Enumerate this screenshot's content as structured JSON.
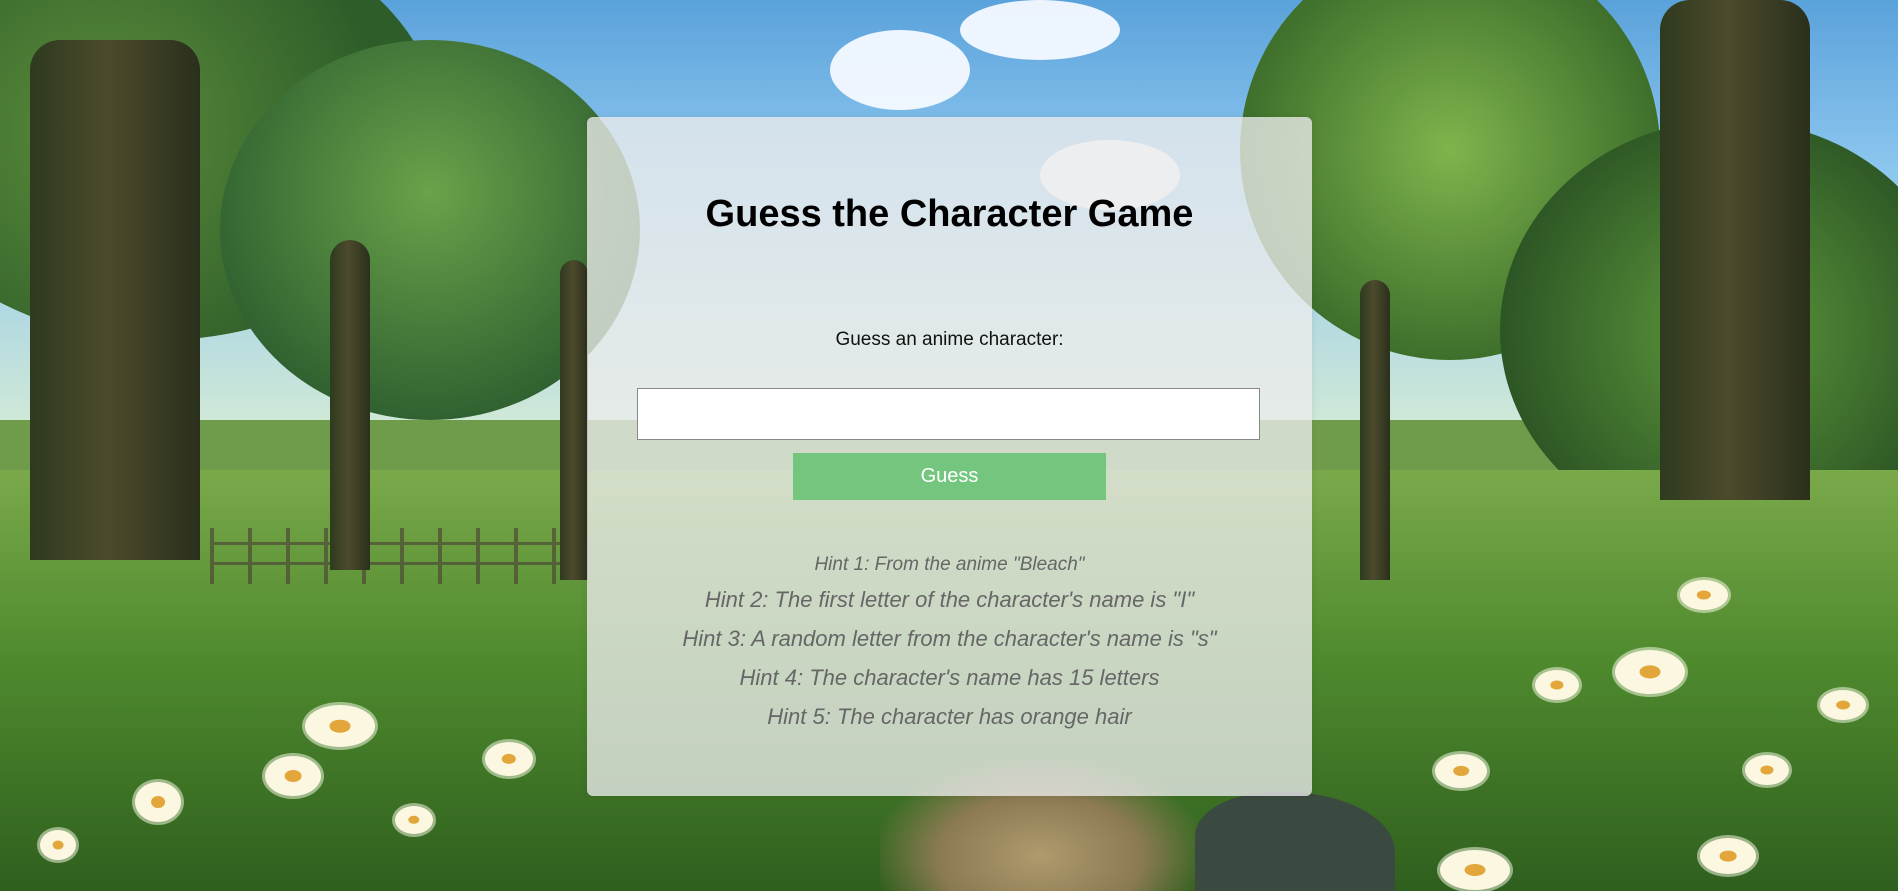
{
  "game": {
    "title": "Guess the Character Game",
    "prompt_label": "Guess an anime character:",
    "input_value": "",
    "input_placeholder": "",
    "guess_button_label": "Guess"
  },
  "hints": [
    "Hint 1: From the anime \"Bleach\"",
    "Hint 2: The first letter of the character's name is \"I\"",
    "Hint 3: A random letter from the character's name is \"s\"",
    "Hint 4: The character's name has 15 letters",
    "Hint 5: The character has orange hair"
  ],
  "colors": {
    "button": "#74c67e",
    "card": "rgba(236,236,236,0.78)",
    "hint_text": "#666666"
  }
}
